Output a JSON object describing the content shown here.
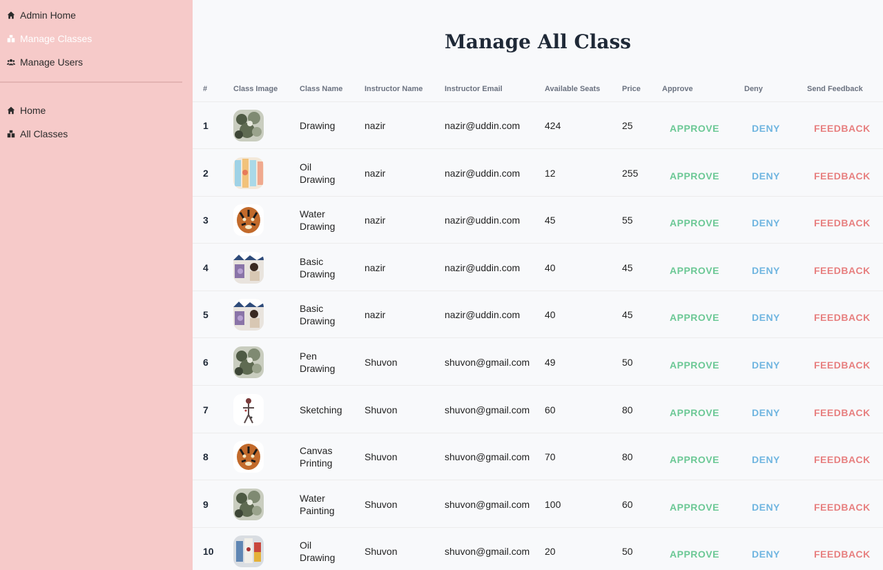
{
  "sidebar": {
    "admin_items": [
      {
        "label": "Admin Home",
        "icon": "home-icon",
        "active": false
      },
      {
        "label": "Manage Classes",
        "icon": "classes-icon",
        "active": true
      },
      {
        "label": "Manage Users",
        "icon": "users-icon",
        "active": false
      }
    ],
    "general_items": [
      {
        "label": "Home",
        "icon": "home-icon"
      },
      {
        "label": "All Classes",
        "icon": "classes-icon"
      }
    ]
  },
  "main": {
    "title": "Manage All Class",
    "headers": [
      "#",
      "Class Image",
      "Class Name",
      "Instructor Name",
      "Instructor Email",
      "Available Seats",
      "Price",
      "Approve",
      "Deny",
      "Send Feedback"
    ],
    "actions": {
      "approve": "APPROVE",
      "deny": "DENY",
      "feedback": "FEEDBACK"
    },
    "rows": [
      {
        "num": "1",
        "image": "plant-sketch",
        "name": "Drawing",
        "instructor": "nazir",
        "email": "nazir@uddin.com",
        "seats": "424",
        "price": "25"
      },
      {
        "num": "2",
        "image": "color-panels",
        "name": "Oil Drawing",
        "instructor": "nazir",
        "email": "nazir@uddin.com",
        "seats": "12",
        "price": "255"
      },
      {
        "num": "3",
        "image": "tiger",
        "name": "Water Drawing",
        "instructor": "nazir",
        "email": "nazir@uddin.com",
        "seats": "45",
        "price": "55"
      },
      {
        "num": "4",
        "image": "artist-painting",
        "name": "Basic Drawing",
        "instructor": "nazir",
        "email": "nazir@uddin.com",
        "seats": "40",
        "price": "45"
      },
      {
        "num": "5",
        "image": "artist-painting",
        "name": "Basic Drawing",
        "instructor": "nazir",
        "email": "nazir@uddin.com",
        "seats": "40",
        "price": "45"
      },
      {
        "num": "6",
        "image": "plant-sketch",
        "name": "Pen Drawing",
        "instructor": "Shuvon",
        "email": "shuvon@gmail.com",
        "seats": "49",
        "price": "50"
      },
      {
        "num": "7",
        "image": "figure-sketch",
        "name": "Sketching",
        "instructor": "Shuvon",
        "email": "shuvon@gmail.com",
        "seats": "60",
        "price": "80"
      },
      {
        "num": "8",
        "image": "tiger",
        "name": "Canvas Printing",
        "instructor": "Shuvon",
        "email": "shuvon@gmail.com",
        "seats": "70",
        "price": "80"
      },
      {
        "num": "9",
        "image": "plant-sketch",
        "name": "Water Painting",
        "instructor": "Shuvon",
        "email": "shuvon@gmail.com",
        "seats": "100",
        "price": "60"
      },
      {
        "num": "10",
        "image": "paint-jars",
        "name": "Oil Drawing",
        "instructor": "Shuvon",
        "email": "shuvon@gmail.com",
        "seats": "20",
        "price": "50"
      }
    ]
  },
  "colors": {
    "sidebar_bg": "#f6cac9",
    "approve": "#6bc895",
    "deny": "#6fb5e0",
    "feedback": "#e77f7f"
  }
}
